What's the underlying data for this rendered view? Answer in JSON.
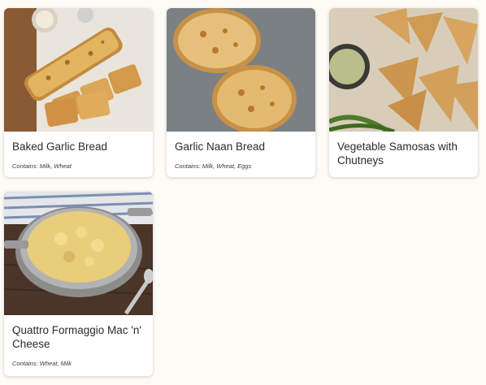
{
  "menu_items": [
    {
      "title": "Baked Garlic Bread",
      "contains": "Contains: Milk, Wheat",
      "image": "baked-garlic-bread-photo"
    },
    {
      "title": "Garlic Naan Bread",
      "contains": "Contains: Milk, Wheat, Eggs",
      "image": "garlic-naan-bread-photo"
    },
    {
      "title": "Vegetable Samosas with Chutneys",
      "contains": "",
      "image": "vegetable-samosas-photo"
    },
    {
      "title": "Quattro Formaggio Mac 'n' Cheese",
      "contains": "Contains: Wheat, Milk",
      "image": "mac-n-cheese-photo"
    }
  ],
  "colors": {
    "page_background": "#fdfbf6",
    "card_background": "#ffffff",
    "title_text": "#2b2b2b"
  }
}
